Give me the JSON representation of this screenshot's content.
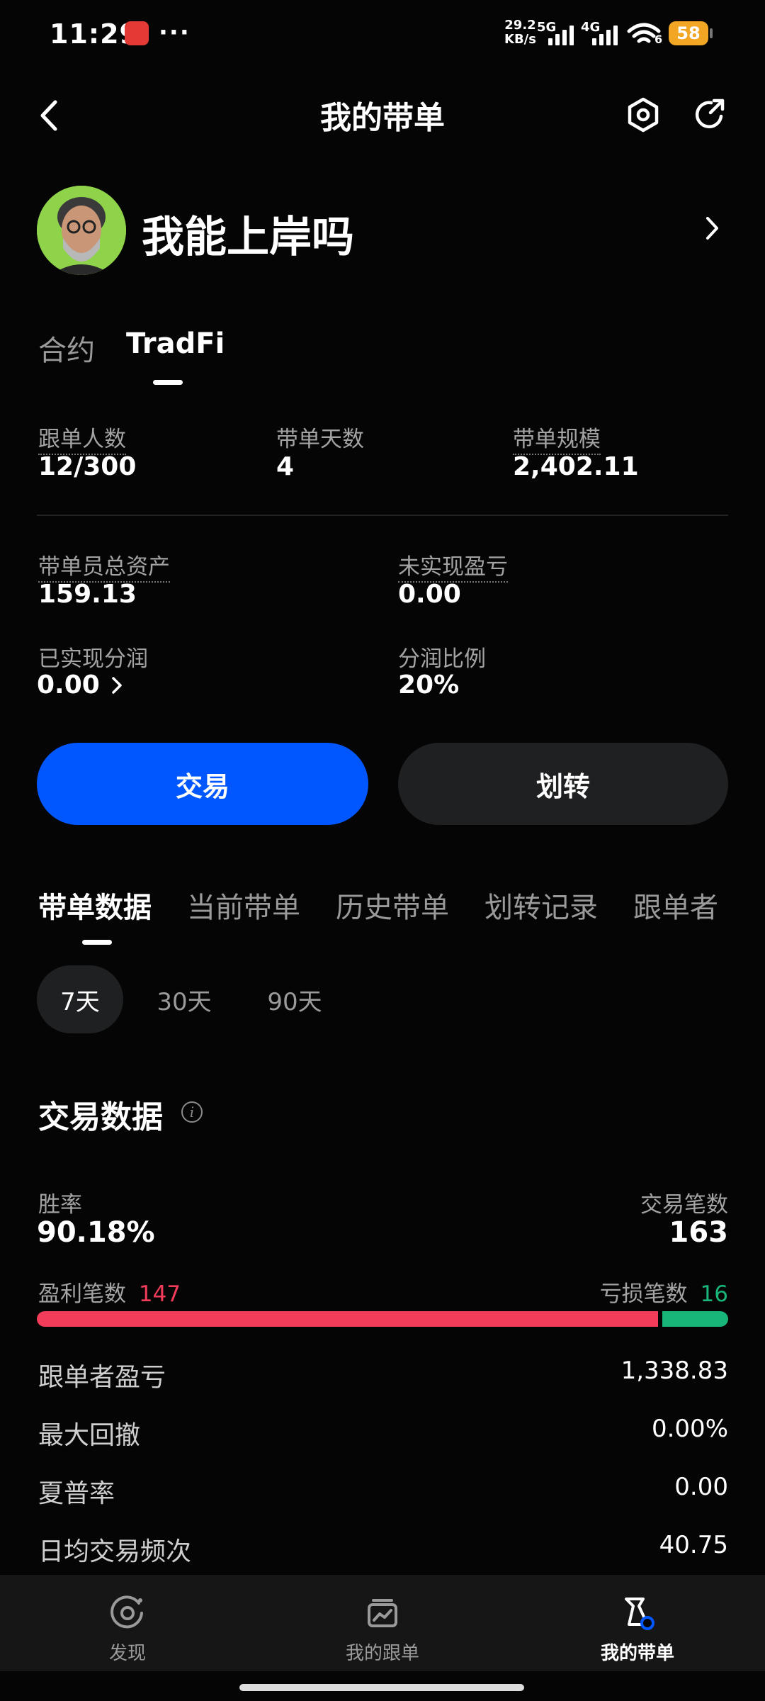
{
  "status_bar": {
    "time": "11:29",
    "more": "···",
    "net_speed_value": "29.2",
    "net_speed_unit": "KB/s",
    "signal_1_type": "5G",
    "signal_2_type": "4G",
    "wifi_suffix": "6",
    "battery": "58"
  },
  "header": {
    "title": "我的带单"
  },
  "profile": {
    "nickname": "我能上岸吗"
  },
  "top_tabs": [
    {
      "label": "合约",
      "active": false
    },
    {
      "label": "TradFi",
      "active": true
    }
  ],
  "stats_row1": [
    {
      "label": "跟单人数",
      "value": "12/300"
    },
    {
      "label": "带单天数",
      "value": "4"
    },
    {
      "label": "带单规模",
      "value": "2,402.11"
    }
  ],
  "stats_row2": [
    {
      "label": "带单员总资产",
      "value": "159.13"
    },
    {
      "label": "未实现盈亏",
      "value": "0.00"
    }
  ],
  "stats_row3": [
    {
      "label": "已实现分润",
      "value": "0.00"
    },
    {
      "label": "分润比例",
      "value": "20%"
    }
  ],
  "actions": {
    "trade": "交易",
    "transfer": "划转"
  },
  "section_tabs": [
    {
      "label": "带单数据",
      "active": true
    },
    {
      "label": "当前带单",
      "active": false
    },
    {
      "label": "历史带单",
      "active": false
    },
    {
      "label": "划转记录",
      "active": false
    },
    {
      "label": "跟单者",
      "active": false
    }
  ],
  "periods": [
    {
      "label": "7天",
      "active": true
    },
    {
      "label": "30天",
      "active": false
    },
    {
      "label": "90天",
      "active": false
    }
  ],
  "trade_data": {
    "title": "交易数据",
    "win_rate_label": "胜率",
    "win_rate": "90.18%",
    "trade_count_label": "交易笔数",
    "trade_count": "163",
    "profit_count_label": "盈利笔数",
    "profit_count": "147",
    "loss_count_label": "亏损笔数",
    "loss_count": "16",
    "win_fraction": 0.9018
  },
  "metrics": [
    {
      "label": "跟单者盈亏",
      "value": "1,338.83"
    },
    {
      "label": "最大回撤",
      "value": "0.00%"
    },
    {
      "label": "夏普率",
      "value": "0.00"
    },
    {
      "label": "日均交易频次",
      "value": "40.75"
    }
  ],
  "bottom_nav": [
    {
      "label": "发现",
      "active": false
    },
    {
      "label": "我的跟单",
      "active": false
    },
    {
      "label": "我的带单",
      "active": true
    }
  ],
  "colors": {
    "accent": "#0057ff",
    "profit": "#f23c5a",
    "loss": "#19b67a",
    "battery": "#f2a623"
  }
}
